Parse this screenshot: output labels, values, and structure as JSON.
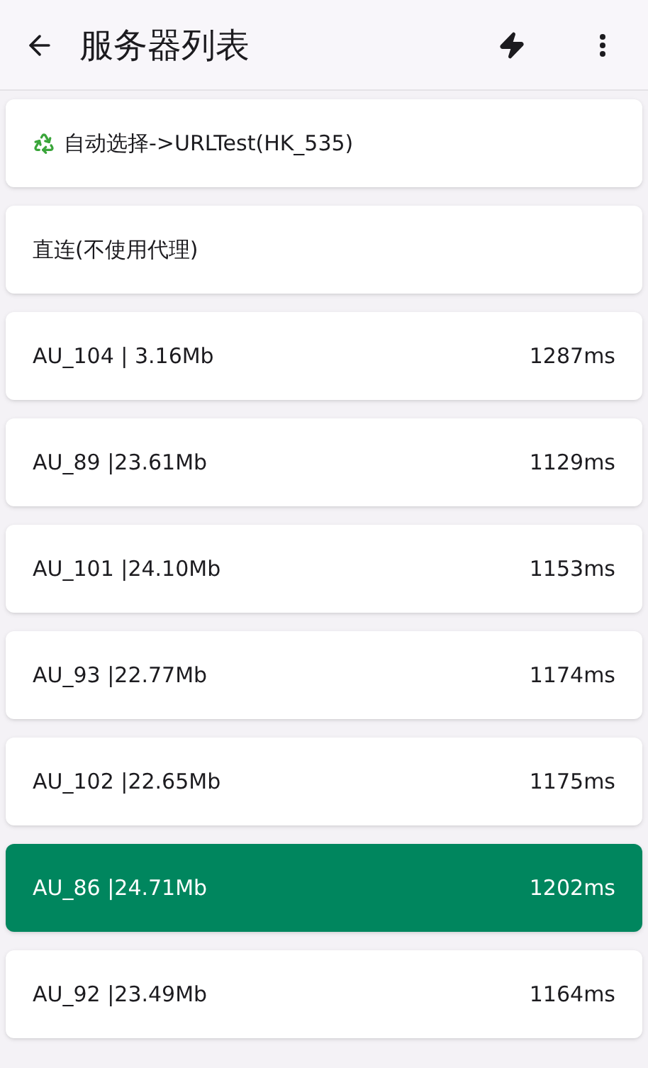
{
  "app_bar": {
    "title": "服务器列表"
  },
  "servers": [
    {
      "kind": "auto",
      "name": "自动选择->URLTest(HK_535)",
      "selected": false
    },
    {
      "kind": "plain",
      "name": "直连(不使用代理)",
      "selected": false
    },
    {
      "kind": "node",
      "name": "AU_104 | 3.16Mb",
      "latency": "1287ms",
      "selected": false
    },
    {
      "kind": "node",
      "name": "AU_89 |23.61Mb",
      "latency": "1129ms",
      "selected": false
    },
    {
      "kind": "node",
      "name": "AU_101 |24.10Mb",
      "latency": "1153ms",
      "selected": false
    },
    {
      "kind": "node",
      "name": "AU_93 |22.77Mb",
      "latency": "1174ms",
      "selected": false
    },
    {
      "kind": "node",
      "name": "AU_102 |22.65Mb",
      "latency": "1175ms",
      "selected": false
    },
    {
      "kind": "node",
      "name": "AU_86 |24.71Mb",
      "latency": "1202ms",
      "selected": true
    },
    {
      "kind": "node",
      "name": "AU_92 |23.49Mb",
      "latency": "1164ms",
      "selected": false
    }
  ]
}
